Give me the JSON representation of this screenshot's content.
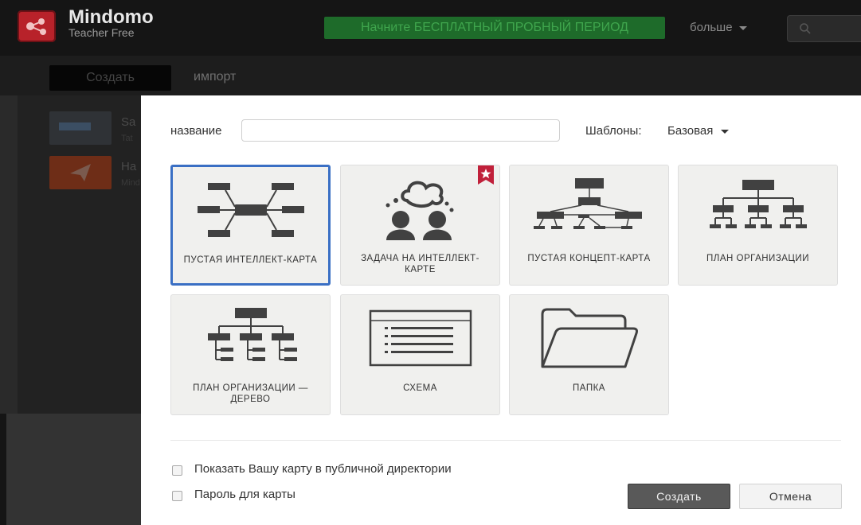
{
  "app": {
    "brand": "Mindomo",
    "plan": "Teacher Free",
    "trial_button": "Начните БЕСПЛАТНЫЙ ПРОБНЫЙ ПЕРИОД",
    "more_menu": "больше",
    "create_button": "Создать",
    "import_link": "импорт",
    "maps": [
      {
        "title": "Sa",
        "meta": "Tat"
      },
      {
        "title": "Ha",
        "meta": "Mind"
      }
    ]
  },
  "modal": {
    "name_label": "название",
    "name_value": "",
    "templates_label": "Шаблоны:",
    "templates_value": "Базовая",
    "tiles": [
      {
        "label": "ПУСТАЯ ИНТЕЛЛЕКТ-КАРТА",
        "icon": "mindmap-icon",
        "selected": true
      },
      {
        "label": "ЗАДАЧА НА ИНТЕЛЛЕКТ-КАРТЕ",
        "icon": "brainstorm-people-icon",
        "premium": true
      },
      {
        "label": "ПУСТАЯ КОНЦЕПТ-КАРТА",
        "icon": "concept-map-icon"
      },
      {
        "label": "ПЛАН ОРГАНИЗАЦИИ",
        "icon": "org-chart-icon"
      },
      {
        "label": "ПЛАН ОРГАНИЗАЦИИ — ДЕРЕВО",
        "icon": "org-tree-icon"
      },
      {
        "label": "СХЕМА",
        "icon": "outline-icon"
      },
      {
        "label": "ПАПКА",
        "icon": "folder-icon"
      }
    ],
    "public_checkbox_label": "Показать Вашу карту в публичной директории",
    "password_checkbox_label": "Пароль для карты",
    "submit_button": "Создать",
    "cancel_button": "Отмена"
  },
  "colors": {
    "selected_border": "#3a6fc4",
    "trial_bg": "#1e6b2a",
    "premium_badge": "#c0203a"
  }
}
